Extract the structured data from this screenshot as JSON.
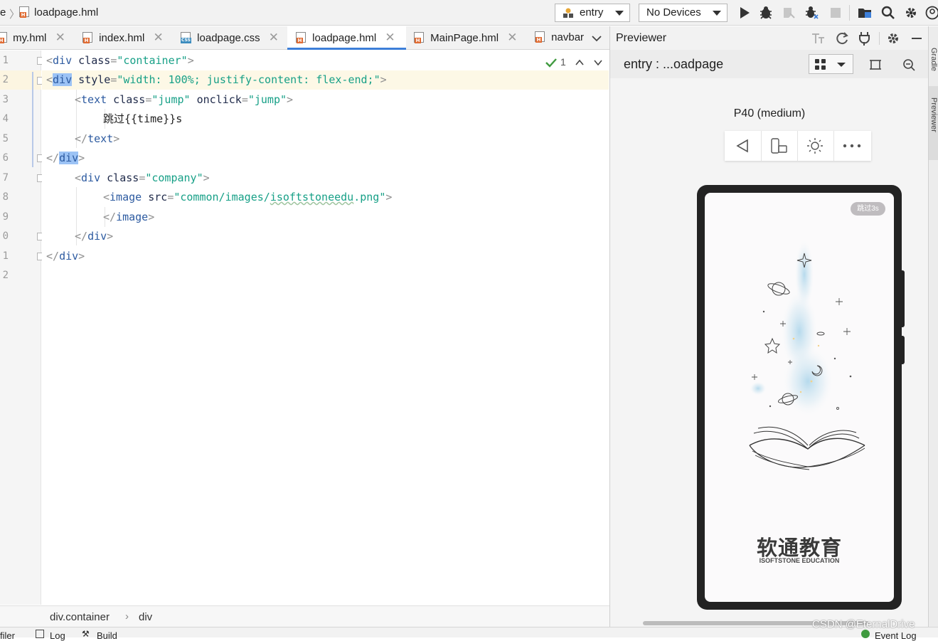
{
  "topbar": {
    "crumb_prefix": "e",
    "crumb_file": "loadpage.hml",
    "module_select": "entry",
    "device_select": "No Devices"
  },
  "tabs": [
    {
      "label": "my.hml",
      "type": "hml"
    },
    {
      "label": "index.hml",
      "type": "hml"
    },
    {
      "label": "loadpage.css",
      "type": "css"
    },
    {
      "label": "loadpage.hml",
      "type": "hml",
      "active": true
    },
    {
      "label": "MainPage.hml",
      "type": "hml"
    },
    {
      "label": "navbar",
      "type": "hml"
    }
  ],
  "editor": {
    "line_numbers": [
      "1",
      "2",
      "3",
      "4",
      "5",
      "6",
      "7",
      "8",
      "9",
      "0",
      "1",
      "2"
    ],
    "inspection_count": "1",
    "code": {
      "l1": {
        "lt": "<",
        "tag": "div",
        "attr": " class",
        "eq": "=",
        "val": "\"container\"",
        "gt": ">"
      },
      "l2": {
        "lt": "<",
        "tag": "div",
        "attr": " style",
        "eq": "=",
        "val": "\"width: 100%; justify-content: flex-end;\"",
        "gt": ">"
      },
      "l3": {
        "lt": "<",
        "tag": "text",
        "attr1": " class",
        "eq1": "=",
        "val1": "\"jump\"",
        "attr2": " onclick",
        "eq2": "=",
        "val2": "\"jump\"",
        "gt": ">"
      },
      "l4": {
        "text": "跳过{{time}}s"
      },
      "l5": {
        "lt": "</",
        "tag": "text",
        "gt": ">"
      },
      "l6": {
        "lt": "</",
        "tag": "div",
        "gt": ">"
      },
      "l7": {
        "lt": "<",
        "tag": "div",
        "attr": " class",
        "eq": "=",
        "val": "\"company\"",
        "gt": ">"
      },
      "l8": {
        "lt": "<",
        "tag": "image",
        "attr": " src",
        "eq": "=",
        "val_q1": "\"common/images/",
        "val_u": "isoftstoneedu",
        "val_q2": ".png\"",
        "gt": ">"
      },
      "l9": {
        "lt": "</",
        "tag": "image",
        "gt": ">"
      },
      "l10": {
        "lt": "</",
        "tag": "div",
        "gt": ">"
      },
      "l11": {
        "lt": "</",
        "tag": "div",
        "gt": ">"
      }
    },
    "breadcrumb": [
      "div.container",
      "div"
    ]
  },
  "previewer": {
    "title": "Previewer",
    "page_label": "entry : ...oadpage",
    "device_name": "P40 (medium)",
    "screen": {
      "skip_badge": "跳过3s",
      "brand_cn": "软通教育",
      "brand_en": "ISOFTSTONE EDUCATION"
    }
  },
  "sidebar_right": [
    "Gradle",
    "Previewer"
  ],
  "bottombar": {
    "items": [
      "filer",
      "Log",
      "Build",
      "Event Log"
    ]
  },
  "watermark": "CSDN @EternalDrive",
  "colors": {
    "accent": "#3d7fd9",
    "tag": "#2c5aa0",
    "string": "#17a087",
    "current_line": "#fdf8e6",
    "match_highlight": "#9cc3f5"
  }
}
